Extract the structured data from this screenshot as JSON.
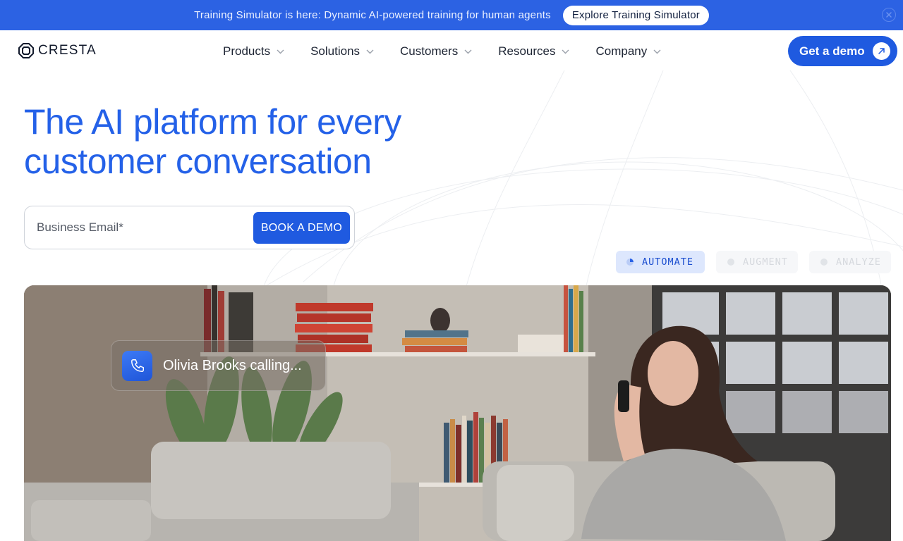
{
  "announcement": {
    "text": "Training Simulator is here: Dynamic AI-powered training for human agents",
    "button_label": "Explore Training Simulator",
    "close_icon": "close-icon"
  },
  "nav": {
    "logo_text": "CRESTA",
    "items": [
      {
        "label": "Products"
      },
      {
        "label": "Solutions"
      },
      {
        "label": "Customers"
      },
      {
        "label": "Resources"
      },
      {
        "label": "Company"
      }
    ],
    "cta_label": "Get a demo",
    "cta_icon": "arrow-up-right-icon"
  },
  "hero": {
    "title_line1": "The AI platform for every",
    "title_line2": "customer conversation",
    "email_placeholder": "Business Email*",
    "book_label": "BOOK A DEMO"
  },
  "modes": {
    "items": [
      {
        "label": "AUTOMATE",
        "active": true
      },
      {
        "label": "AUGMENT",
        "active": false
      },
      {
        "label": "ANALYZE",
        "active": false
      }
    ]
  },
  "video": {
    "call_text": "Olivia Brooks calling...",
    "call_icon": "phone-icon"
  },
  "colors": {
    "brand_blue": "#2461e8",
    "announcement_bg": "#2c62e3",
    "button_blue": "#1f5ae0",
    "active_pill_bg": "#dde7fd"
  }
}
